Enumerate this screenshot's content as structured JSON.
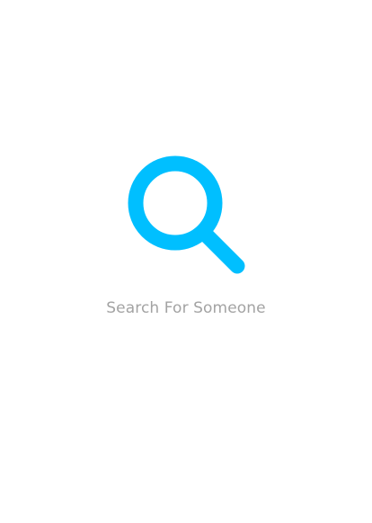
{
  "empty_state": {
    "icon": "search-icon",
    "message": "Search For Someone"
  },
  "colors": {
    "background": "#ffffff",
    "accent": "#00bfff",
    "message_text": "#a3a3a3"
  }
}
